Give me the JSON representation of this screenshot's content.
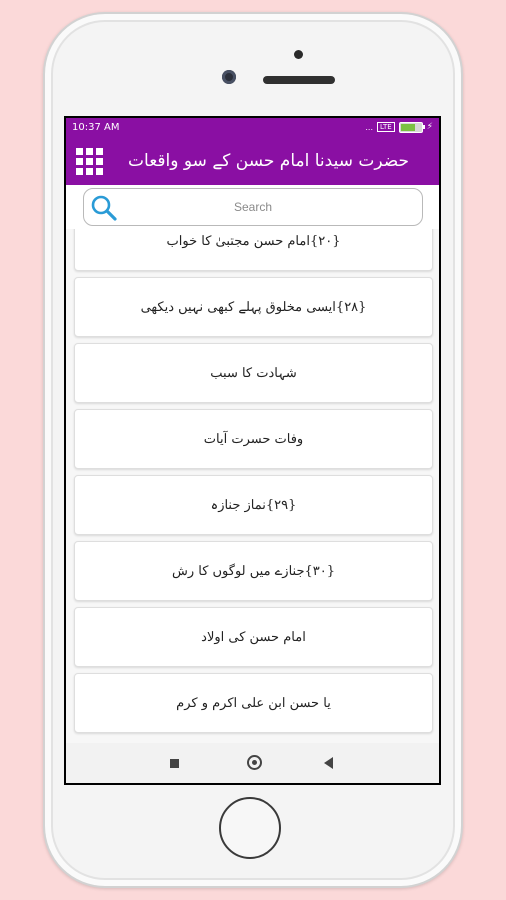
{
  "status_bar": {
    "time": "10:37 AM",
    "signal_text": "...",
    "sim_label": "LTE",
    "battery_level": 0.7,
    "battery_icon": "battery-icon",
    "charging_icon": "bolt-icon"
  },
  "app_bar": {
    "title": "حضرت سیدنا امام حسن کے سو واقعات",
    "menu_icon": "grid-menu-icon"
  },
  "search": {
    "placeholder": "Search",
    "icon": "search-icon"
  },
  "list": {
    "items": [
      {
        "label": "{۲۰}امام حسن مجتبیٰ کا خواب"
      },
      {
        "label": "{۲۸}ایسی مخلوق پہلے کبھی نہیں دیکھی"
      },
      {
        "label": "شہادت کا سبب"
      },
      {
        "label": "وفات حسرت آیات"
      },
      {
        "label": "{۲۹}نماز جنازہ"
      },
      {
        "label": "{۳۰}جنازے میں لوگوں کا رش"
      },
      {
        "label": "امام حسن کی اولاد"
      },
      {
        "label": "یا حسن ابن علی اکرم و کرم"
      }
    ]
  },
  "nav_bar": {
    "recents_icon": "recents-square-icon",
    "home_icon": "home-circle-icon",
    "back_icon": "back-triangle-icon"
  },
  "colors": {
    "primary": "#8a0fa3",
    "background": "#fbd9d9"
  }
}
